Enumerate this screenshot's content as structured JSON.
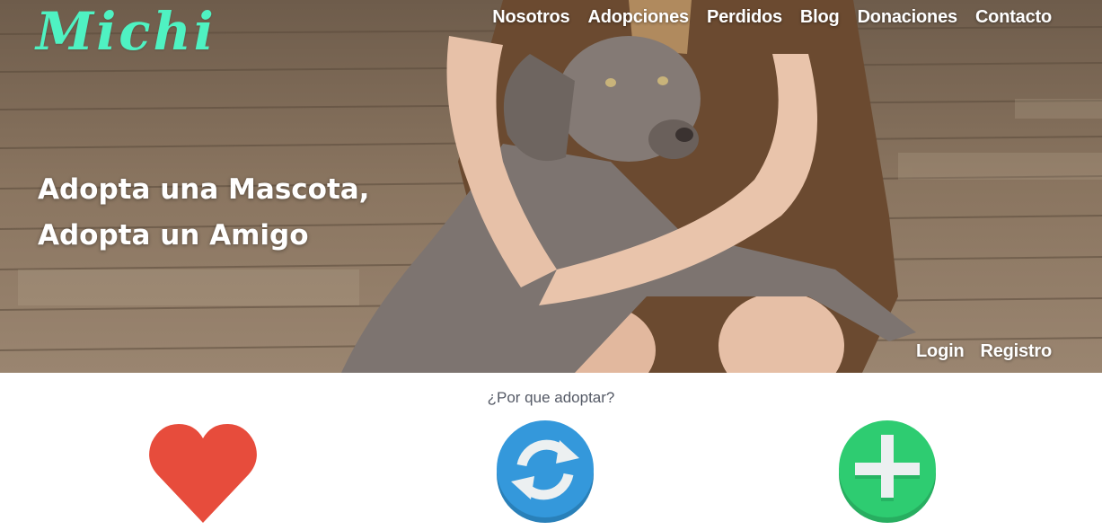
{
  "brand": {
    "logo_text": "Michi",
    "logo_color": "#4ff2c2"
  },
  "nav": {
    "items": [
      {
        "label": "Nosotros"
      },
      {
        "label": "Adopciones"
      },
      {
        "label": "Perdidos"
      },
      {
        "label": "Blog"
      },
      {
        "label": "Donaciones"
      },
      {
        "label": "Contacto"
      }
    ]
  },
  "hero": {
    "headline_line1": "Adopta una Mascota,",
    "headline_line2": "Adopta un Amigo",
    "image": "woman-hugging-grey-dog-on-wooden-deck"
  },
  "auth": {
    "login_label": "Login",
    "register_label": "Registro"
  },
  "why_adopt": {
    "title": "¿Por que adoptar?",
    "features": [
      {
        "icon": "heart-icon",
        "color": "#e74c3c"
      },
      {
        "icon": "refresh-icon",
        "color": "#3498db"
      },
      {
        "icon": "plus-icon",
        "color": "#2ecc71"
      }
    ]
  }
}
